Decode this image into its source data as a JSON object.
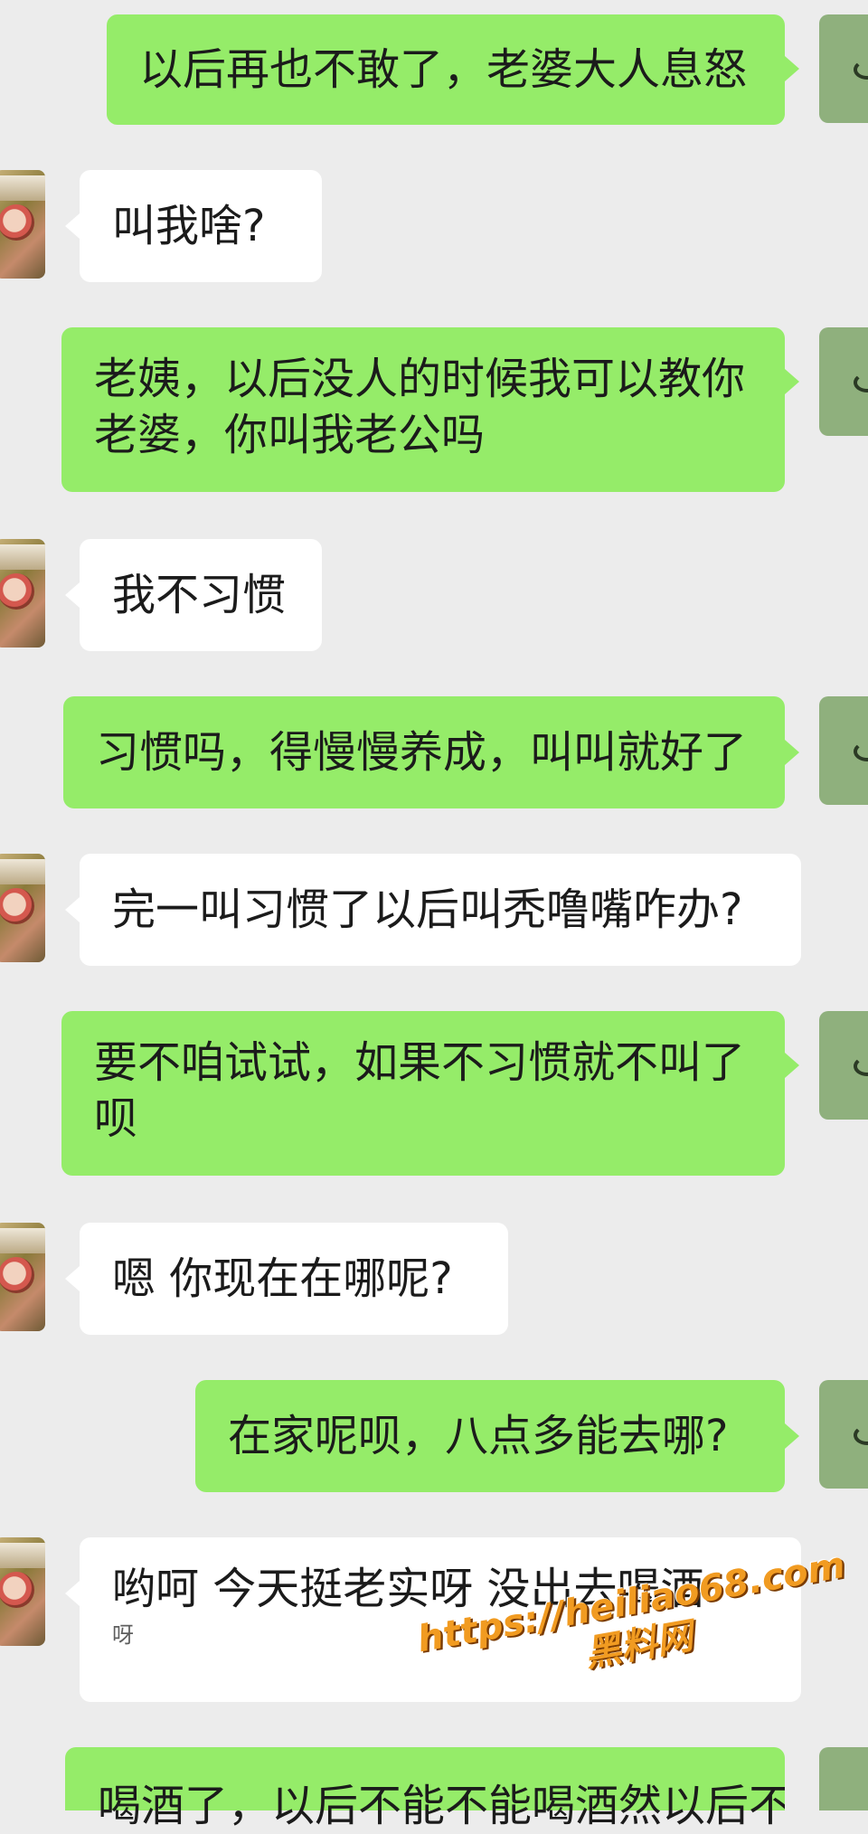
{
  "messages": [
    {
      "from": "me",
      "text": "以后再也不敢了，老婆大人息怒"
    },
    {
      "from": "them",
      "text": "叫我啥?"
    },
    {
      "from": "me",
      "lines": [
        "老姨，以后没人的时候我可以教你",
        "老婆，你叫我老公吗"
      ]
    },
    {
      "from": "them",
      "text": "我不习惯"
    },
    {
      "from": "me",
      "text": "习惯吗，得慢慢养成，叫叫就好了"
    },
    {
      "from": "them",
      "text": "完一叫习惯了以后叫秃噜嘴咋办?"
    },
    {
      "from": "me",
      "lines": [
        "要不咱试试，如果不习惯就不叫了",
        "呗"
      ]
    },
    {
      "from": "them",
      "text": "嗯 你现在在哪呢?"
    },
    {
      "from": "me",
      "text": "在家呢呗，八点多能去哪?"
    },
    {
      "from": "them",
      "lines": [
        "哟呵 今天挺老实呀 没出去喝酒",
        "呀"
      ]
    },
    {
      "from": "me",
      "text": "喝酒了，以后不能不能喝酒然以后不"
    }
  ],
  "watermark": {
    "url": "https://heiliao68.com",
    "site": "黑料网",
    "color": "#f19b21"
  },
  "colors": {
    "background": "#ececec",
    "my_bubble": "#95ec69",
    "their_bubble": "#ffffff"
  },
  "icons": {
    "my_avatar": "user-avatar-icon",
    "their_avatar": "contact-avatar-icon"
  }
}
